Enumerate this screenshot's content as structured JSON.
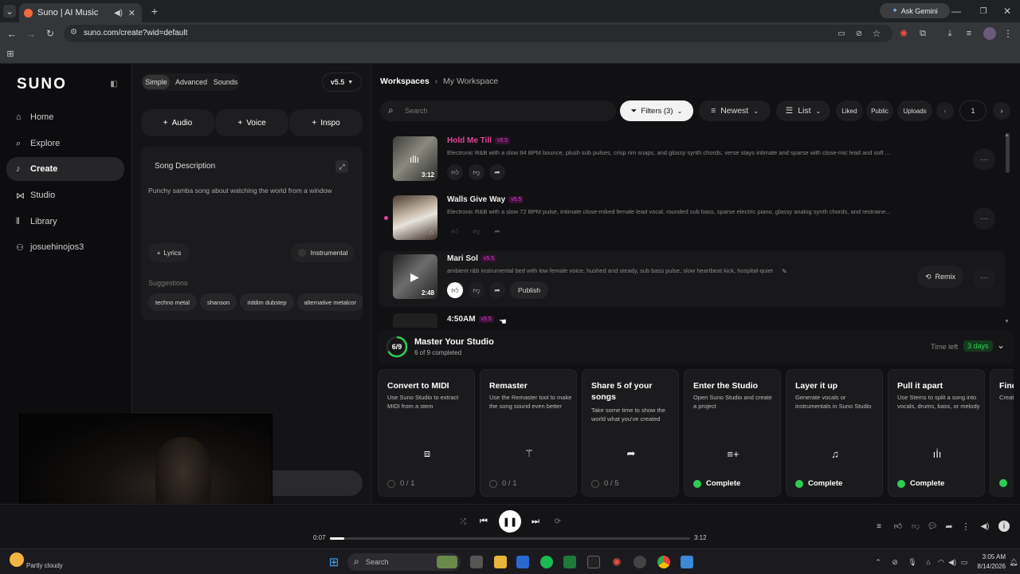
{
  "browser": {
    "tab_title": "Suno | AI Music",
    "url": "suno.com/create?wid=default",
    "ask_gemini": "Ask Gemini"
  },
  "nav": {
    "logo": "SUNO",
    "items": [
      {
        "label": "Home",
        "icon": "home-icon"
      },
      {
        "label": "Explore",
        "icon": "search-icon"
      },
      {
        "label": "Create",
        "icon": "music-note-icon"
      },
      {
        "label": "Studio",
        "icon": "studio-icon"
      },
      {
        "label": "Library",
        "icon": "library-icon"
      },
      {
        "label": "josuehinojos3",
        "icon": "user-icon"
      }
    ]
  },
  "create": {
    "modes": [
      "Simple",
      "Advanced",
      "Sounds"
    ],
    "version": "v5.5",
    "add_buttons": [
      "Audio",
      "Voice",
      "Inspo"
    ],
    "song_description_label": "Song Description",
    "song_description_value": "Punchy samba song about watching the world from a window",
    "lyrics_label": "Lyrics",
    "instrumental_label": "Instrumental",
    "suggestions_label": "Suggestions",
    "suggestions": [
      "techno metal",
      "shanson",
      "riddim dubstep",
      "alternative metalcor"
    ]
  },
  "workspace": {
    "breadcrumb_root": "Workspaces",
    "breadcrumb_current": "My Workspace",
    "search_placeholder": "Search",
    "filters_label": "Filters (3)",
    "sort_label": "Newest",
    "view_label": "List",
    "toggles": [
      "Liked",
      "Public",
      "Uploads"
    ],
    "page": "1"
  },
  "songs": [
    {
      "title": "Hold Me Till",
      "version": "v5.5",
      "duration": "3:12",
      "desc": "Electronic R&B with a slow 84 BPM bounce, plush sub pulses, crisp rim snaps, and glossy synth chords, verse stays intimate and sparse with close-mic lead and soft ...",
      "color": "#e0459a"
    },
    {
      "title": "Walls Give Way",
      "version": "v5.5",
      "duration": "",
      "desc": "Electronic R&B with a slow 72 BPM pulse, intimate close-miked female lead vocal, rounded sub bass, sparse electric piano, glassy analog synth chords, and restraine...",
      "color": "#eeeeee"
    },
    {
      "title": "Mari Sol",
      "version": "v5.5",
      "duration": "2:48",
      "desc": "ambient r&b instrumental bed with low female voice, hushed and steady, sub bass pulse, slow heartbeat kick, hospital-quiet",
      "color": "#eeeeee",
      "publish": "Publish",
      "remix": "Remix"
    },
    {
      "title": "4:50AM",
      "version": "v5.5",
      "duration": "",
      "desc": "",
      "color": "#eeeeee"
    }
  ],
  "studio_tasks": {
    "progress": "6/9",
    "progress_fraction": 0.667,
    "title": "Master Your Studio",
    "subtitle": "6 of 9 completed",
    "time_left_label": "Time left",
    "time_left_value": "3 days",
    "cards": [
      {
        "title": "Convert to MIDI",
        "desc": "Use Suno Studio to extract MIDI from a stem",
        "icon": "midi-file-icon",
        "status": "0 / 1",
        "done": false
      },
      {
        "title": "Remaster",
        "desc": "Use the Remaster tool to make the song sound even better",
        "icon": "magic-wand-icon",
        "status": "0 / 1",
        "done": false
      },
      {
        "title": "Share 5 of your songs",
        "desc": "Take some time to show the world what you've created",
        "icon": "share-icon",
        "status": "0 / 5",
        "done": false
      },
      {
        "title": "Enter the Studio",
        "desc": "Open Suno Studio and create a project",
        "icon": "add-playlist-icon",
        "status": "Complete",
        "done": true
      },
      {
        "title": "Layer it up",
        "desc": "Generate vocals or instrumentals in Suno Studio",
        "icon": "music-note-icon",
        "status": "Complete",
        "done": true
      },
      {
        "title": "Pull it apart",
        "desc": "Use Stems to split a song into vocals, drums, bass, or melody",
        "icon": "waveform-icon",
        "status": "Complete",
        "done": true
      },
      {
        "title": "Find",
        "desc": "Creat voice",
        "icon": "",
        "status": "",
        "done": true
      }
    ]
  },
  "player": {
    "elapsed": "0:07",
    "duration": "3:12",
    "progress_fraction": 0.04
  },
  "taskbar": {
    "weather": "Partly cloudy",
    "search": "Search",
    "time": "3:05 AM",
    "date": "8/14/2026"
  }
}
